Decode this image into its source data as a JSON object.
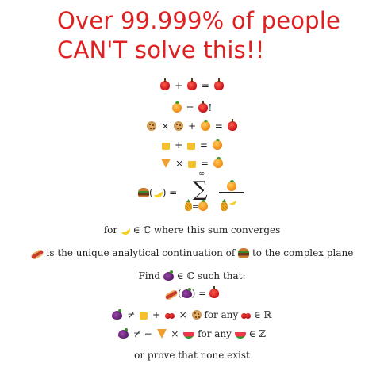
{
  "headline": {
    "line1": "Over 99.999% of people",
    "line2": "CAN'T solve this!!"
  },
  "equations": {
    "eq1": {
      "op": "+",
      "eq": "="
    },
    "eq2": {
      "eq": "=",
      "suffix": "!"
    },
    "eq3": {
      "op1": "×",
      "op2": "+",
      "eq": "="
    },
    "eq4": {
      "op": "+",
      "eq": "="
    },
    "eq5": {
      "op": "×",
      "eq": "="
    },
    "eq6": {
      "lhs_open": "(",
      "lhs_close": ") =",
      "sigma": "∑",
      "upper": "∞",
      "sub_eq": "="
    }
  },
  "text": {
    "for_prefix": "for",
    "converges": "∈ ℂ where this sum converges",
    "continuation_mid": "is the unique analytical continuation of",
    "continuation_end": "to the complex plane",
    "find_prefix": "Find",
    "find_suffix": "∈ ℂ such that:",
    "cond1_open": "(",
    "cond1_close": ") =",
    "cond2_neq": "≠",
    "cond2_plus": "+",
    "cond2_times": "×",
    "cond2_forany": "for any",
    "cond2_set": "∈ ℝ",
    "cond3_neq": "≠ −",
    "cond3_times": "×",
    "cond3_forany": "for any",
    "cond3_set": "∈ ℤ",
    "closing": "or prove that none exist"
  },
  "icons": {
    "apple": "apple-icon",
    "orange": "orange-icon",
    "cookie": "cookie-icon",
    "beer": "beer-icon",
    "pizza": "pizza-icon",
    "burger": "burger-icon",
    "banana": "banana-icon",
    "pineapple": "pineapple-icon",
    "hotdog": "hotdog-icon",
    "eggplant": "eggplant-icon",
    "cherries": "cherries-icon",
    "watermelon": "watermelon-icon"
  },
  "colors": {
    "headline": "#e02020",
    "text": "#222222",
    "background": "#ffffff"
  }
}
